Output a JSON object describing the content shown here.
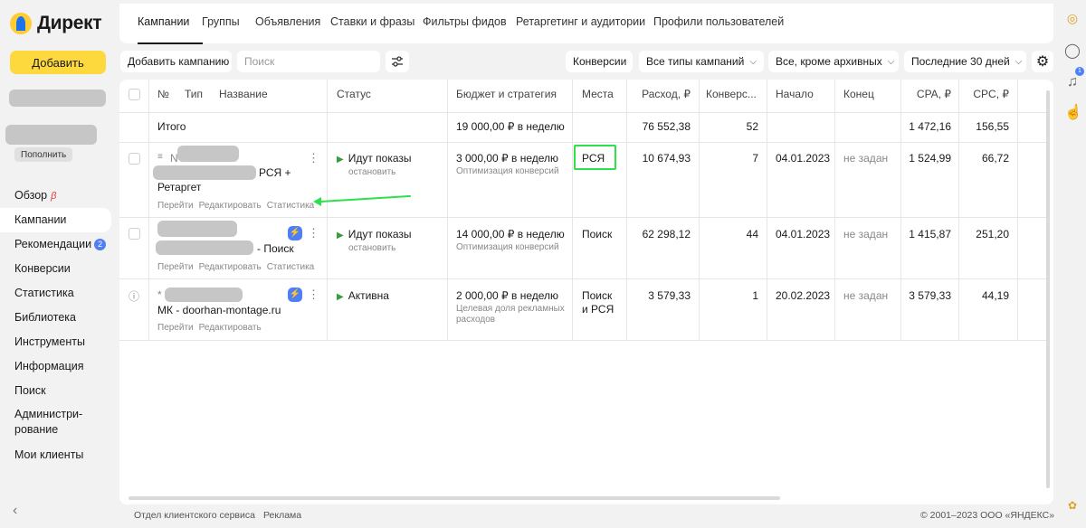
{
  "app": {
    "logo_text": "Директ",
    "add_button": "Добавить",
    "top_up_button": "Пополнить"
  },
  "nav": [
    {
      "label": "Обзор",
      "badge": "β"
    },
    {
      "label": "Кампании",
      "active": true
    },
    {
      "label": "Рекомендации",
      "count": "2"
    },
    {
      "label": "Конверсии"
    },
    {
      "label": "Статистика"
    },
    {
      "label": "Библиотека"
    },
    {
      "label": "Инструменты"
    },
    {
      "label": "Информация"
    },
    {
      "label": "Поиск"
    },
    {
      "label": "Администри-\nрование"
    },
    {
      "label": "Мои клиенты"
    }
  ],
  "tabs": [
    "Кампании",
    "Группы",
    "Объявления",
    "Ставки и фразы",
    "Фильтры фидов",
    "Ретаргетинг и аудитории",
    "Профили пользователей"
  ],
  "toolbar": {
    "add_campaign": "Добавить кампанию",
    "search_placeholder": "Поиск",
    "conversions": "Конверсии",
    "campaign_types": "Все типы кампаний",
    "archive_filter": "Все, кроме архивных",
    "period": "Последние 30 дней"
  },
  "table": {
    "headers": {
      "num": "№",
      "type": "Тип",
      "name": "Название",
      "status": "Статус",
      "budget": "Бюджет и стратегия",
      "places": "Места",
      "spend": "Расход, ₽",
      "conversions": "Конверс...",
      "start": "Начало",
      "end": "Конец",
      "cpa": "CPA, ₽",
      "cpc": "CPC, ₽"
    },
    "total": {
      "label": "Итого",
      "budget": "19 000,00 ₽ в неделю",
      "spend": "76 552,38",
      "conversions": "52",
      "cpa": "1 472,16",
      "cpc": "156,55"
    },
    "rows": [
      {
        "type_prefix": "N",
        "name_suffix": "РСЯ +",
        "name_line2": "Ретаргет",
        "links": [
          "Перейти",
          "Редактировать",
          "Статистика"
        ],
        "status": "Идут показы",
        "status_action": "остановить",
        "budget": "3 000,00 ₽ в неделю",
        "strategy": "Оптимизация конверсий",
        "places": "РСЯ",
        "spend": "10 674,93",
        "conversions": "7",
        "start": "04.01.2023",
        "end": "не задан",
        "cpa": "1 524,99",
        "cpc": "66,72"
      },
      {
        "name_suffix": "- Поиск",
        "links": [
          "Перейти",
          "Редактировать",
          "Статистика"
        ],
        "status": "Идут показы",
        "status_action": "остановить",
        "budget": "14 000,00 ₽ в неделю",
        "strategy": "Оптимизация конверсий",
        "places": "Поиск",
        "spend": "62 298,12",
        "conversions": "44",
        "start": "04.01.2023",
        "end": "не задан",
        "cpa": "1 415,87",
        "cpc": "251,20"
      },
      {
        "type_prefix": "*",
        "name": "МК - doorhan-montage.ru",
        "links": [
          "Перейти",
          "Редактировать"
        ],
        "status": "Активна",
        "budget": "2 000,00 ₽ в неделю",
        "strategy_line1": "Целевая доля рекламных",
        "strategy_line2": "расходов",
        "places_line1": "Поиск",
        "places_line2": "и РСЯ",
        "spend": "3 579,33",
        "conversions": "1",
        "start": "20.02.2023",
        "end": "не задан",
        "cpa": "3 579,33",
        "cpc": "44,19"
      }
    ]
  },
  "footer": {
    "service": "Отдел клиентского сервиса",
    "ads": "Реклама",
    "copyright": "© 2001–2023 ООО «ЯНДЕКС»"
  },
  "rail": {
    "notification_count": "1"
  },
  "colors": {
    "accent": "#fdd93d",
    "brand_blue": "#4f7ef5",
    "highlight": "#2ee04a"
  }
}
